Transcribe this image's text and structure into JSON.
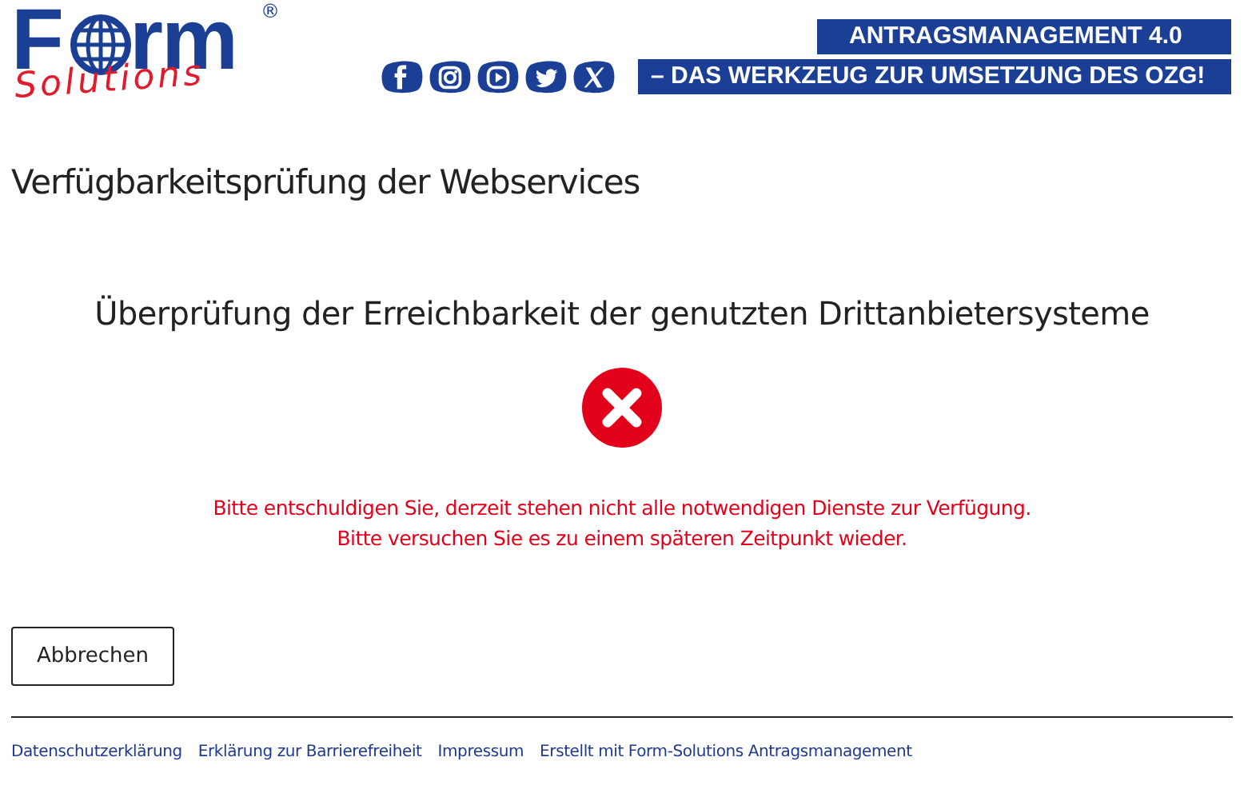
{
  "logo": {
    "text_start": "F",
    "text_end": "rm",
    "subtitle": "Solutions",
    "registered": "®"
  },
  "social_links": [
    {
      "kind": "facebook"
    },
    {
      "kind": "instagram"
    },
    {
      "kind": "video"
    },
    {
      "kind": "bird"
    },
    {
      "kind": "x"
    }
  ],
  "banner": {
    "line_1": "ANTRAGSMANAGEMENT 4.0",
    "line_2": "– DAS WERKZEUG ZUR UMSETZUNG DES OZG!"
  },
  "page_title": "Verfügbarkeitsprüfung der Webservices",
  "check": {
    "heading": "Überprüfung der Erreichbarkeit der genutzten Drittanbietersysteme",
    "kind": "error",
    "messages": [
      "Bitte entschuldigen Sie, derzeit stehen nicht alle notwendigen Dienste zur Verfügung.",
      "Bitte versuchen Sie es zu einem späteren Zeitpunkt wieder."
    ]
  },
  "buttons": [
    "Abbrechen"
  ],
  "footer_links": [
    "Datenschutzerklärung",
    "Erklärung zur Barrierefreiheit",
    "Impressum",
    "Erstellt mit Form-Solutions Antragsmanagement"
  ]
}
